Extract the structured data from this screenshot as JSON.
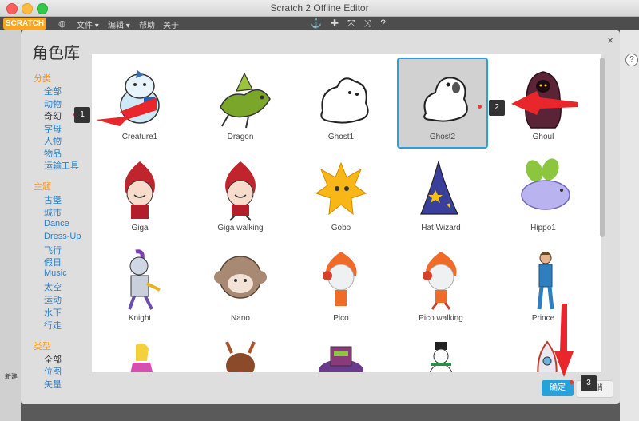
{
  "window": {
    "title": "Scratch 2 Offline Editor"
  },
  "menubar": {
    "logo": "SCRATCH",
    "items": [
      "文件 ▾",
      "编辑 ▾",
      "帮助",
      "关于"
    ]
  },
  "dialog": {
    "title": "角色库",
    "close": "×",
    "categories_head": "分类",
    "categories": [
      "全部",
      "动物",
      "奇幻",
      "字母",
      "人物",
      "物品",
      "运输工具"
    ],
    "themes_head": "主题",
    "themes": [
      "古堡",
      "城市",
      "Dance",
      "Dress-Up",
      "飞行",
      "假日",
      "Music",
      "太空",
      "运动",
      "水下",
      "行走"
    ],
    "types_head": "类型",
    "types": [
      "全部",
      "位图",
      "矢量"
    ],
    "ok": "确定",
    "cancel": "取消"
  },
  "sprites": [
    "Creature1",
    "Dragon",
    "Ghost1",
    "Ghost2",
    "Ghoul",
    "Giga",
    "Giga walking",
    "Gobo",
    "Hat Wizard",
    "Hippo1",
    "Knight",
    "Nano",
    "Pico",
    "Pico walking",
    "Prince"
  ],
  "badges": [
    "1",
    "2",
    "3"
  ],
  "background": {
    "new_label": "新建"
  }
}
